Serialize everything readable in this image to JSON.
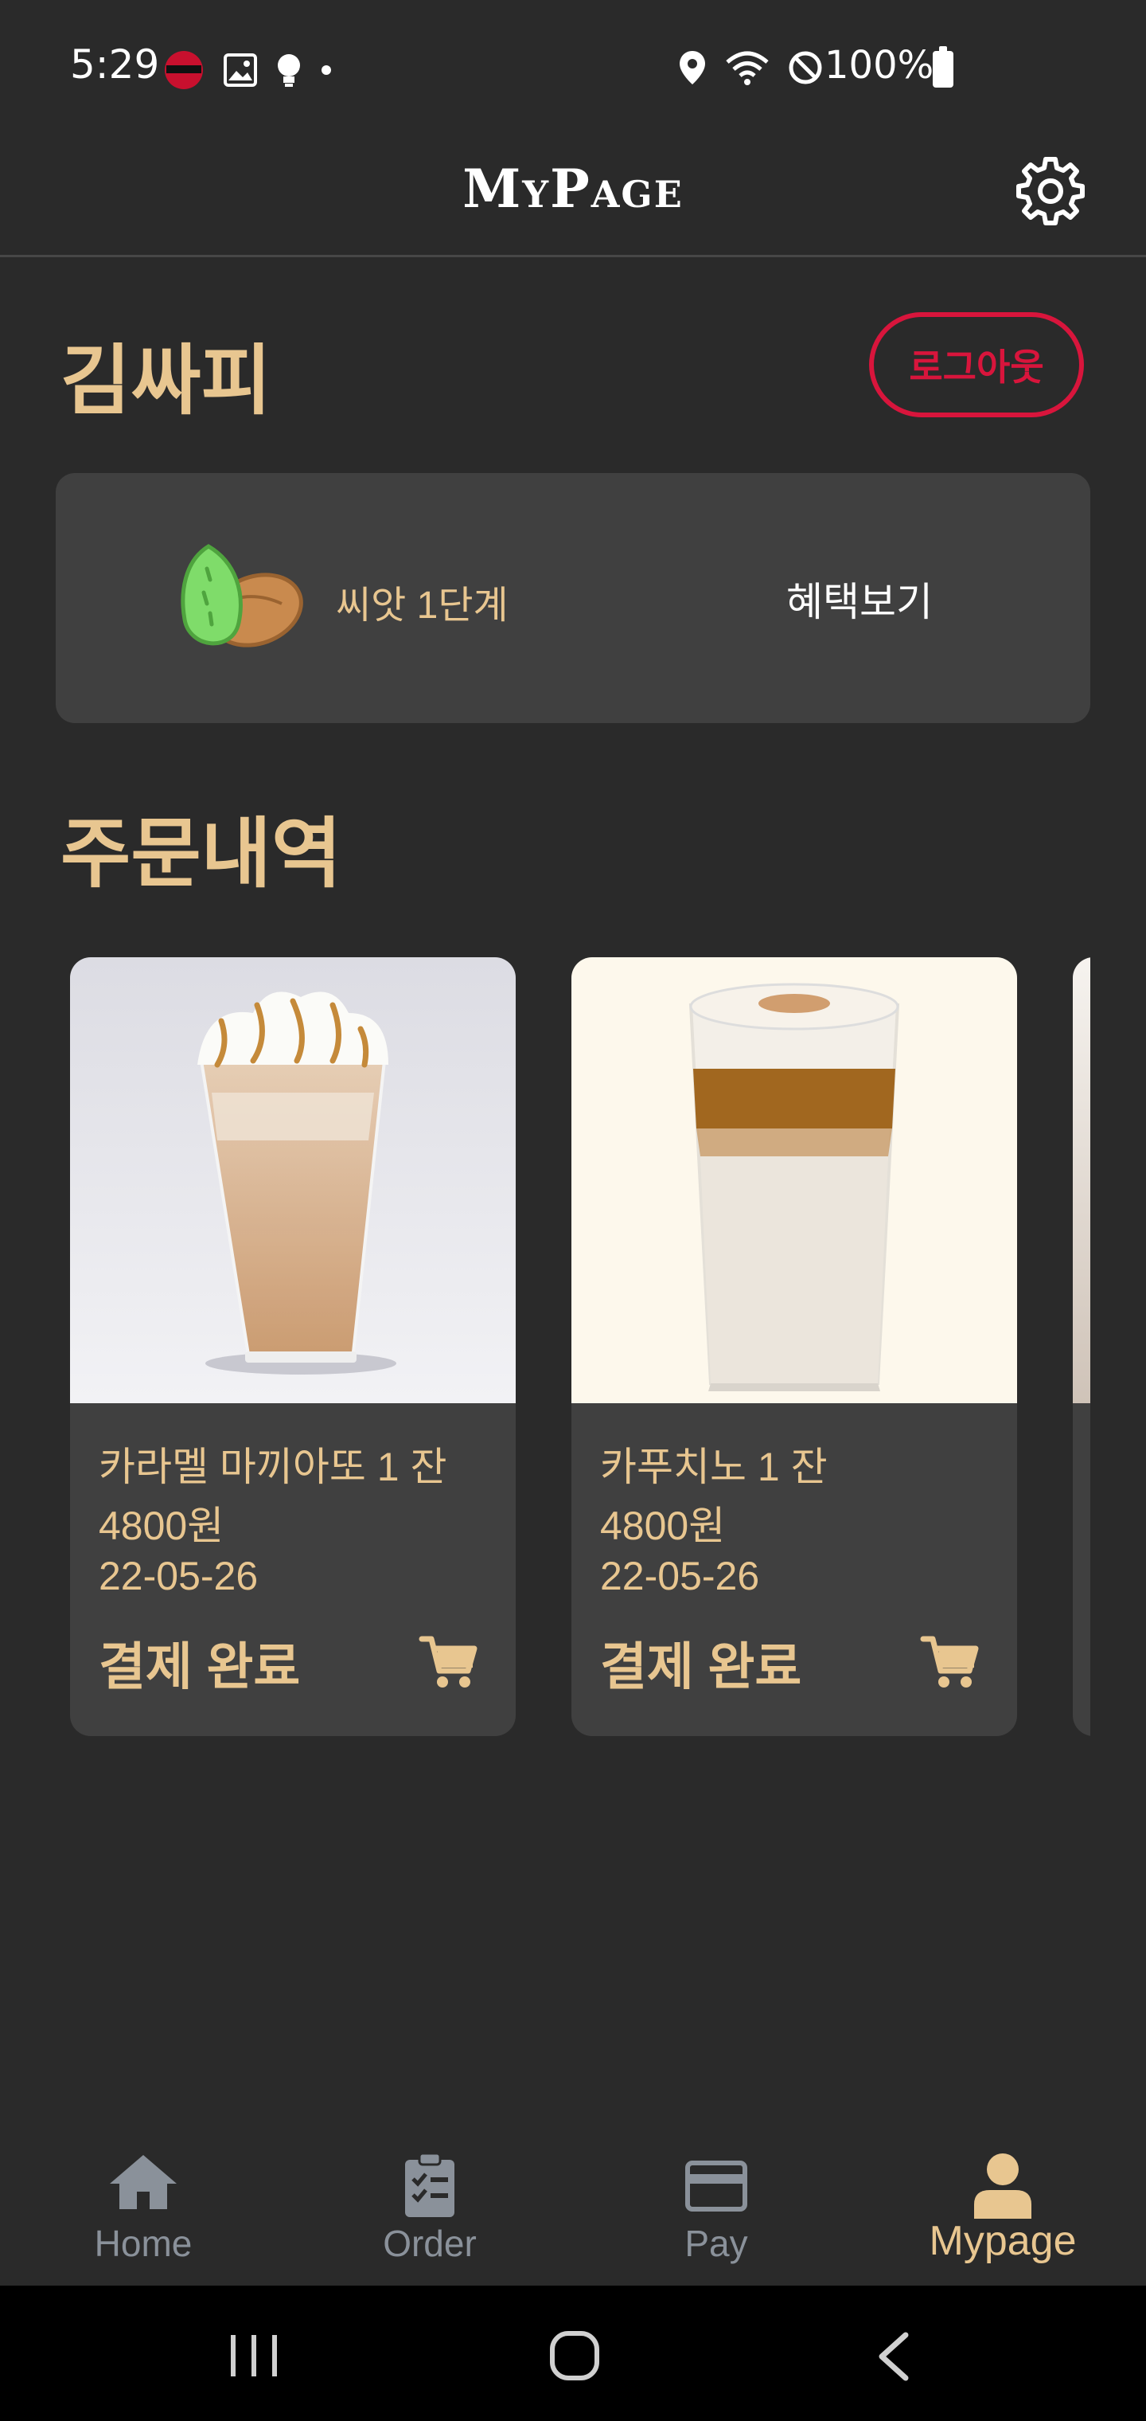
{
  "status_bar": {
    "time": "5:29",
    "battery": "100%"
  },
  "app_bar": {
    "title": "MyPage"
  },
  "user": {
    "name": "김싸피",
    "logout_label": "로그아웃"
  },
  "grade": {
    "label": "씨앗 1단계",
    "benefit_label": "혜택보기"
  },
  "orders": {
    "title": "주문내역",
    "items": [
      {
        "name": "카라멜 마끼아또 1 잔",
        "price": "4800원",
        "date": "22-05-26",
        "status": "결제 완료"
      },
      {
        "name": "카푸치노 1 잔",
        "price": "4800원",
        "date": "22-05-26",
        "status": "결제 완료"
      }
    ]
  },
  "bottom_nav": {
    "items": [
      {
        "label": "Home",
        "icon": "home-icon"
      },
      {
        "label": "Order",
        "icon": "clipboard-icon"
      },
      {
        "label": "Pay",
        "icon": "credit-card-icon"
      },
      {
        "label": "Mypage",
        "icon": "person-icon"
      }
    ],
    "active": "Mypage"
  },
  "colors": {
    "background": "#2a2a2a",
    "card": "#404040",
    "accent": "#e8c690",
    "logout": "#d8153c",
    "nav_inactive": "#8a919a"
  }
}
